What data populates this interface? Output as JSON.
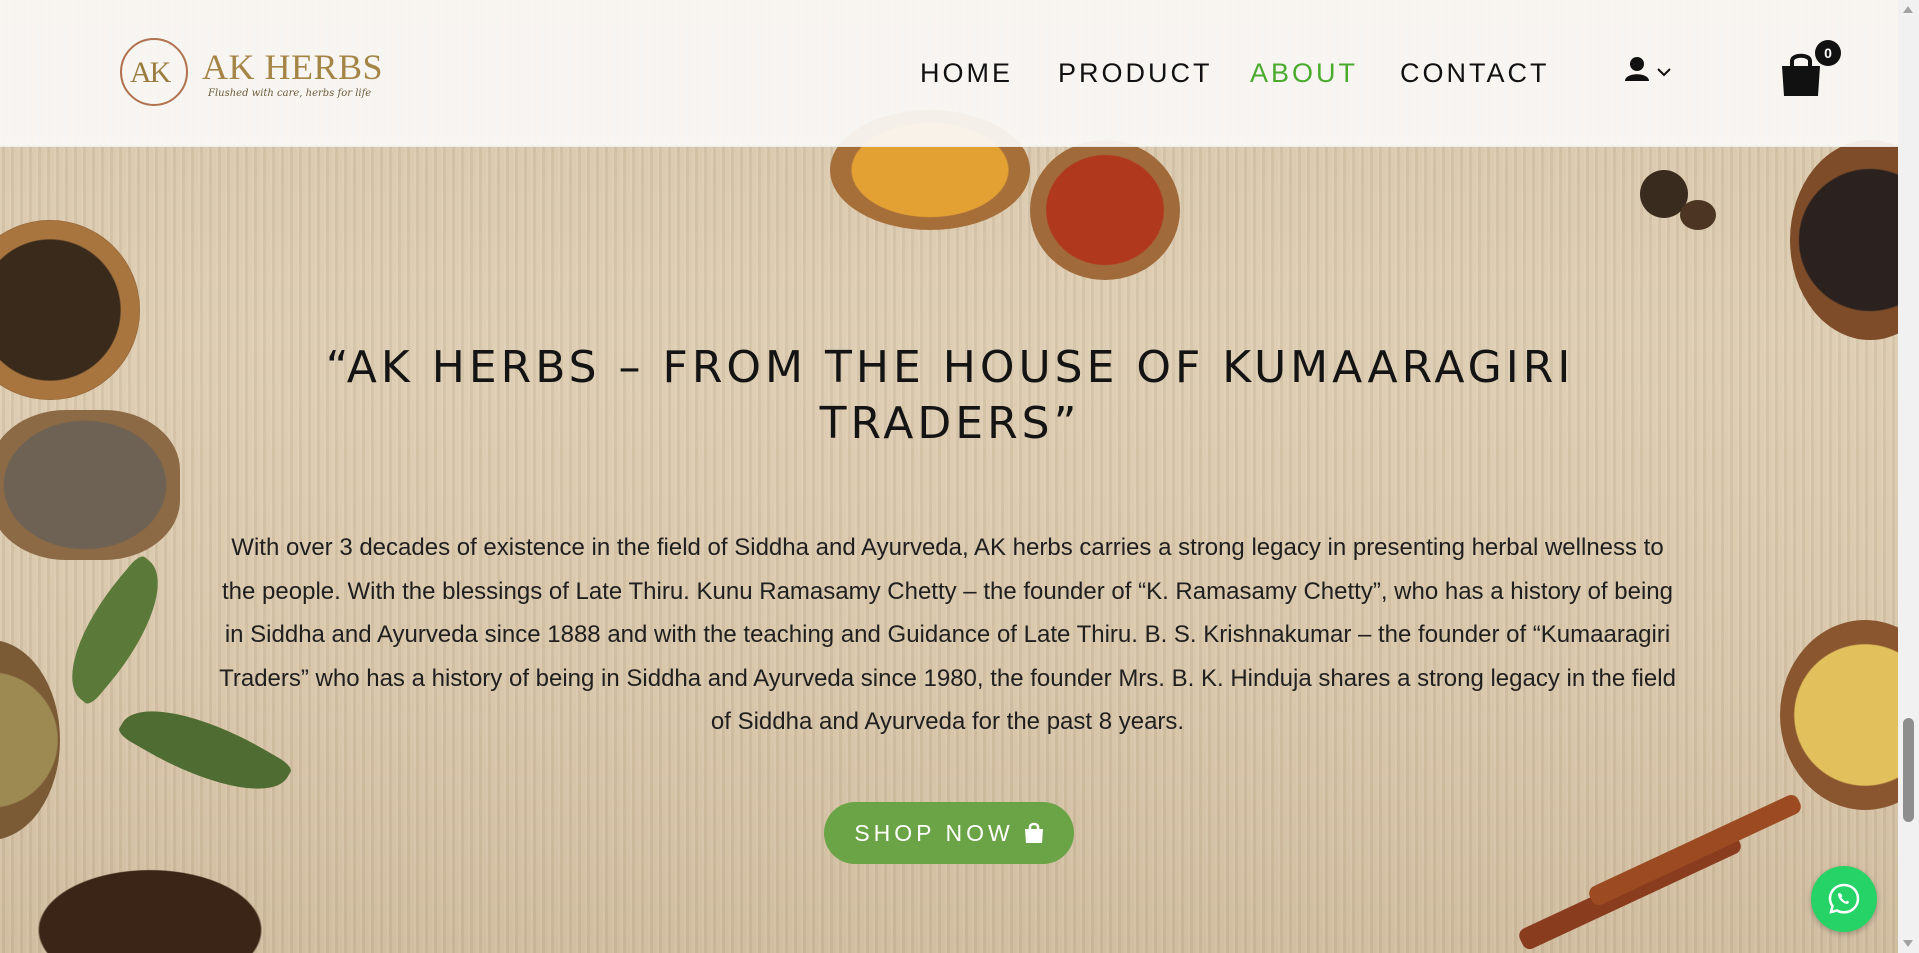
{
  "brand": {
    "name": "AK HERBS",
    "monogram": "AK",
    "tagline": "Flushed with care, herbs for life"
  },
  "nav": {
    "items": [
      {
        "label": "HOME",
        "active": false
      },
      {
        "label": "PRODUCT",
        "active": false
      },
      {
        "label": "ABOUT",
        "active": true
      },
      {
        "label": "CONTACT",
        "active": false
      }
    ],
    "user_icon": "user-icon",
    "cart_icon": "shopping-bag-icon",
    "cart_count": "0"
  },
  "about": {
    "headline": "“AK HERBS – FROM THE HOUSE OF KUMAARAGIRI TRADERS”",
    "body": "With over 3 decades of existence in the field of Siddha and Ayurveda, AK herbs carries a strong legacy in presenting herbal wellness to the people. With the blessings of Late Thiru. Kunu Ramasamy Chetty – the founder of “K. Ramasamy Chetty”, who has a history of being in Siddha and Ayurveda since 1888 and with the teaching and Guidance of Late Thiru. B. S. Krishnakumar – the founder of “Kumaaragiri Traders” who has a history of being in Siddha and Ayurveda since 1980, the founder Mrs. B. K. Hinduja shares a strong legacy in the field of Siddha and Ayurveda for the past 8 years.",
    "cta_label": "SHOP NOW"
  },
  "colors": {
    "accent_green": "#4aab2e",
    "button_green": "#6aa447",
    "whatsapp_green": "#25d366"
  }
}
